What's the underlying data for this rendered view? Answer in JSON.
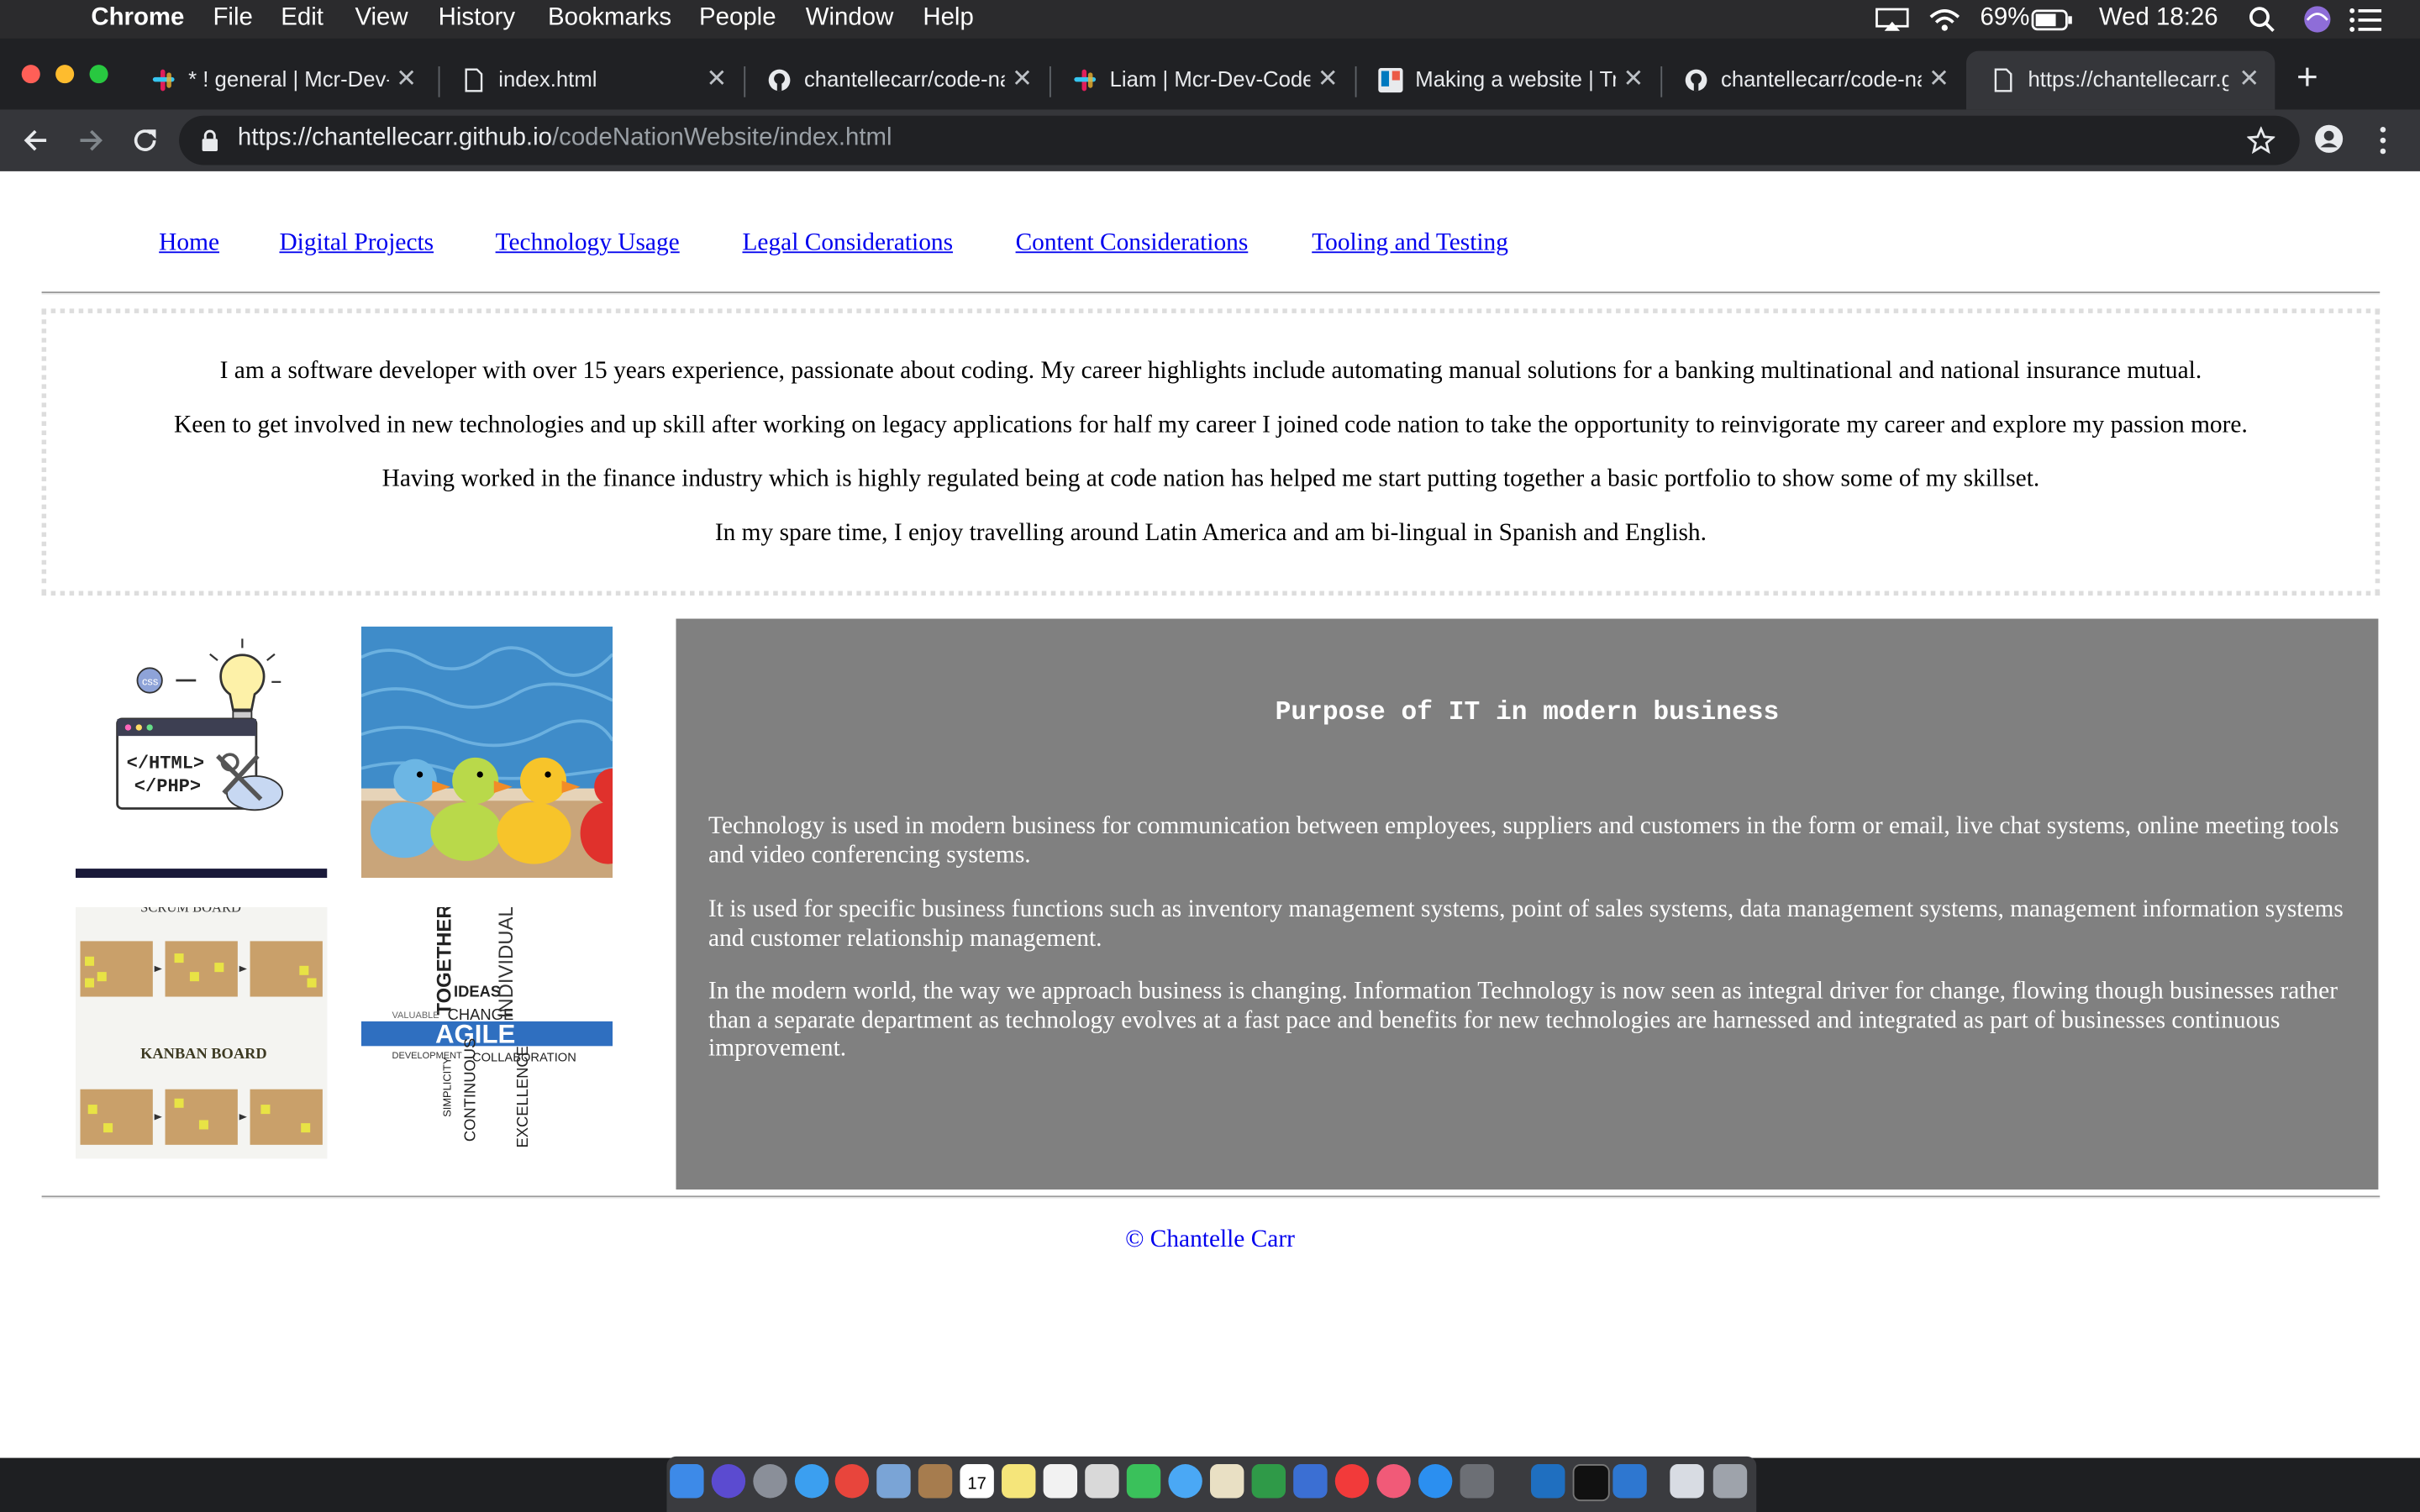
{
  "menubar": {
    "app": "Chrome",
    "items": [
      "File",
      "Edit",
      "View",
      "History",
      "Bookmarks",
      "People",
      "Window",
      "Help"
    ],
    "battery": "69%",
    "clock": "Wed 18:26"
  },
  "tabs": [
    {
      "title": "* ! general | Mcr-Dev-Code-Nation",
      "icon": "slack-icon"
    },
    {
      "title": "index.html",
      "icon": "file-icon"
    },
    {
      "title": "chantellecarr/code-nation",
      "icon": "github-icon"
    },
    {
      "title": "Liam | Mcr-Dev-Code-Nation",
      "icon": "slack-icon"
    },
    {
      "title": "Making a website | Trello",
      "icon": "trello-icon"
    },
    {
      "title": "chantellecarr/code-nation",
      "icon": "github-icon"
    },
    {
      "title": "https://chantellecarr.github.io",
      "icon": "file-icon"
    }
  ],
  "address": {
    "host": "https://chantellecarr.github.io",
    "path": "/codeNationWebsite/index.html"
  },
  "page": {
    "nav": [
      "Home",
      "Digital Projects",
      "Technology Usage",
      "Legal Considerations",
      "Content Considerations",
      "Tooling and Testing"
    ],
    "about": [
      "I am a software developer with over 15 years experience, passionate about coding. My career highlights include automating manual solutions for a banking multinational and national insurance mutual.",
      "Keen to get involved in new technologies and up skill after working on legacy applications for half my career I joined code nation to take the opportunity to reinvigorate my career and explore my passion more.",
      "Having worked in the finance industry which is highly regulated being at code nation has helped me start putting together a basic portfolio to show some of my skillset.",
      "In my spare time, I enjoy travelling around Latin America and am bi-lingual in Spanish and English."
    ],
    "images": {
      "coding": {
        "html": "</HTML>",
        "php": "</PHP>",
        "css": "css"
      },
      "scrum": {
        "top": "SCRUM BOARD",
        "middle": "KANBAN BOARD"
      },
      "agile": {
        "main": "AGILE",
        "together": "TOGETHER",
        "ideas": "IDEAS",
        "change": "CHANGE",
        "individuals": "INDIVIDUALS",
        "collaboration": "COLLABORATION",
        "excellence": "EXCELLENCE",
        "continuous": "CONTINUOUS",
        "development": "DEVELOPMENT",
        "simplicity": "SIMPLICITY",
        "valuable": "VALUABLE"
      }
    },
    "purpose": {
      "heading": "Purpose of IT in modern business",
      "paragraphs": [
        "Technology is used in modern business for communication between employees, suppliers and customers in the form or email, live chat systems, online meeting tools and video conferencing systems.",
        "It is used for specific business functions such as inventory management systems, point of sales systems, data management systems, management information systems and customer relationship management.",
        "In the modern world, the way we approach business is changing. Information Technology is now seen as integral driver for change, flowing though businesses rather than a separate department as technology evolves at a fast pace and benefits for new technologies are harnessed and integrated as part of businesses continuous improvement."
      ]
    },
    "footer": "© Chantelle Carr"
  },
  "dock": {
    "calendar_day": "17",
    "apps": [
      "finder",
      "siri",
      "launchpad",
      "safari",
      "chrome",
      "preview",
      "notes",
      "calendar",
      "stickies",
      "reminders",
      "photos",
      "facetime",
      "messages",
      "maps",
      "numbers",
      "keynote",
      "news",
      "music",
      "app-store",
      "system-preferences",
      "vscode",
      "terminal",
      "xcode",
      "documents",
      "trash"
    ]
  },
  "colors": {
    "page_link": "#0000ee",
    "panel_bg": "#808080",
    "menubar_bg": "#2b2b2d",
    "tabstrip_bg": "#202124",
    "active_tab_bg": "#35363a"
  }
}
